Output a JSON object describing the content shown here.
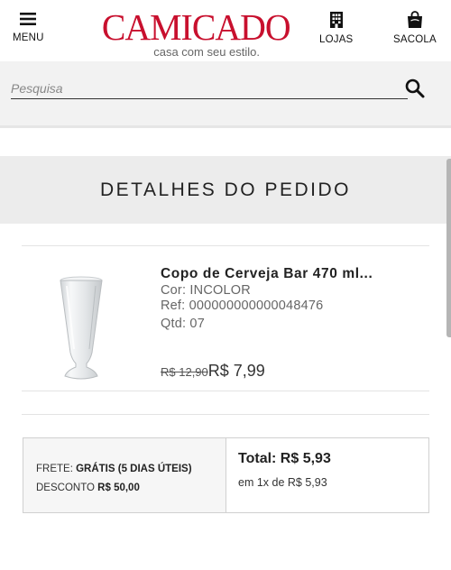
{
  "header": {
    "menu_label": "MENU",
    "logo_text": "CAMICADO",
    "tagline": "casa com seu estilo.",
    "lojas_label": "LOJAS",
    "sacola_label": "SACOLA"
  },
  "search": {
    "placeholder": "Pesquisa",
    "value": ""
  },
  "section_title": "DETALHES DO PEDIDO",
  "product": {
    "name": "Copo de Cerveja Bar 470 ml...",
    "color": "Cor: INCOLOR",
    "ref": "Ref: 000000000000048476",
    "qty": "Qtd: 07",
    "old_price": "R$ 12,90",
    "price": "R$ 7,99"
  },
  "summary": {
    "frete_label": "FRETE:",
    "frete_value": "GRÁTIS (5 DIAS ÚTEIS)",
    "desconto_label": "DESCONTO",
    "desconto_value": "R$ 50,00",
    "total": "Total: R$ 5,93",
    "installments": "em 1x de R$ 5,93"
  },
  "icons": {
    "menu": "hamburger-icon",
    "lojas": "building-icon",
    "sacola": "shopping-bag-icon",
    "search": "search-icon"
  },
  "colors": {
    "brand": "#c8102e",
    "band": "#f2f2f2",
    "title_band": "#ececec"
  }
}
